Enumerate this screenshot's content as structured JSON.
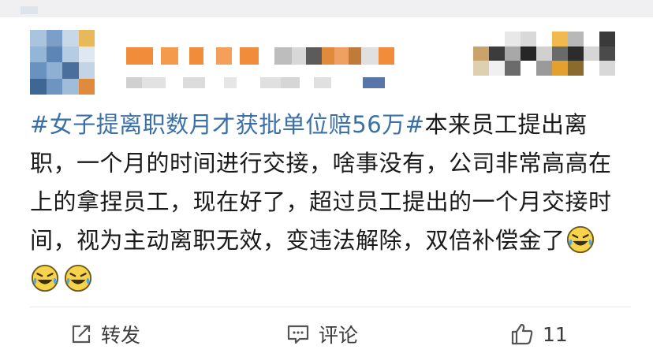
{
  "post": {
    "topic": "#女子提离职数月才获批单位赔56万#",
    "body": "本来员工提出离职，一个月的时间进行交接，啥事没有，公司非常高高在上的拿捏员工，现在好了，超过员工提出的一个月交接时间，视为主动离职无效，变违法解除，双倍补偿金了",
    "emojis": [
      "laugh-cry-emoji",
      "laugh-cry-emoji",
      "laugh-cry-emoji"
    ]
  },
  "actions": {
    "repost_label": "转发",
    "comment_label": "评论",
    "like_count": "11"
  },
  "colors": {
    "topic": "#3a70a8",
    "text": "#1a1a1a",
    "icon": "#555555"
  }
}
